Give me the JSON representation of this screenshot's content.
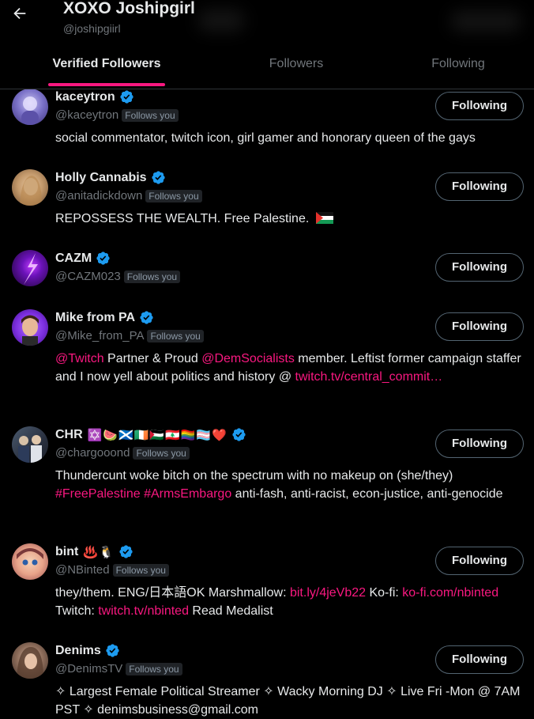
{
  "header": {
    "title": "XOXO Joshipgirl",
    "handle": "@joshipgiirl",
    "tabs": [
      "Verified Followers",
      "Followers",
      "Following"
    ]
  },
  "colors": {
    "accent": "#f91880",
    "verified": "#1d9bf0",
    "muted": "#71767b"
  },
  "users": [
    {
      "name": "kaceytron",
      "handle": "@kaceytron",
      "badge": "Follows you",
      "button": "Following",
      "bio": "social commentator, twitch icon, girl gamer and honorary queen of the gays"
    },
    {
      "name": "Holly Cannabis",
      "handle": "@anitadickdown",
      "badge": "Follows you",
      "button": "Following",
      "bio": "REPOSSESS THE WEALTH. Free Palestine."
    },
    {
      "name": "CAZM",
      "handle": "@CAZM023",
      "badge": "Follows you",
      "button": "Following"
    },
    {
      "name": "Mike from PA",
      "handle": "@Mike_from_PA",
      "badge": "Follows you",
      "button": "Following",
      "bio": {
        "link1": "@Twitch",
        "t1": " Partner & Proud ",
        "link2": "@DemSocialists",
        "t2": " member. Leftist former campaign staffer and I now yell about politics and history @ ",
        "link3": "twitch.tv/central_commit…"
      }
    },
    {
      "name": "CHR",
      "emojis": "✡️🍉🏴󠁧󠁢󠁳󠁣󠁴󠁿🇮🇪🇵🇸🇱🇧🏳️‍🌈🏳️‍⚧️❤️",
      "handle": "@chargooond",
      "badge": "Follows you",
      "button": "Following",
      "bio": {
        "t1": "Thundercunt woke bitch on the spectrum with no makeup on (she/they) ",
        "link1": "#FreePalestine",
        "t2": " ",
        "link2": "#ArmsEmbargo",
        "t3": " anti-fash, anti-racist, econ-justice, anti-genocide"
      }
    },
    {
      "name": "bint",
      "emojis": "♨️🐧",
      "handle": "@NBinted",
      "badge": "Follows you",
      "button": "Following",
      "bio": {
        "t1": "they/them. ENG/日本語OK Marshmallow: ",
        "link1": "bit.ly/4jeVb22",
        "t2": " Ko-fi: ",
        "link2": "ko-fi.com/nbinted",
        "t3": " Twitch: ",
        "link3": "twitch.tv/nbinted",
        "t4": " Read Medalist"
      }
    },
    {
      "name": "Denims",
      "handle": "@DenimsTV",
      "badge": "Follows you",
      "button": "Following",
      "bio": "✧ Largest Female Political Streamer ✧ Wacky Morning DJ ✧ Live Fri -Mon @ 7AM PST ✧ denimsbusiness@gmail.com"
    }
  ]
}
